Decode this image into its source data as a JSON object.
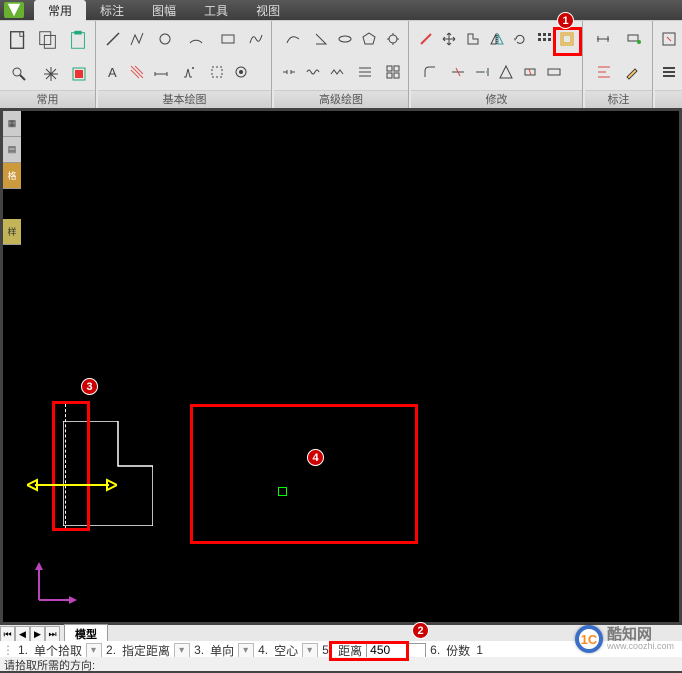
{
  "tabs": {
    "t0": "常用",
    "t1": "标注",
    "t2": "图幅",
    "t3": "工具",
    "t4": "视图"
  },
  "panels": {
    "p0": "常用",
    "p1": "基本绘图",
    "p2": "高级绘图",
    "p3": "修改",
    "p4": "标注"
  },
  "callouts": {
    "c1": "1",
    "c2": "2",
    "c3": "3",
    "c4": "4"
  },
  "model_tab": "模型",
  "options": {
    "o1_num": "1.",
    "o1": "单个拾取",
    "o2_num": "2.",
    "o2": "指定距离",
    "o3_num": "3.",
    "o3": "单向",
    "o4_num": "4.",
    "o4": "空心",
    "o5_num": "5.",
    "o5": "距离",
    "o5_val": "450",
    "o6_num": "6.",
    "o6": "份数",
    "o6_val": "1"
  },
  "status": "请拾取所需的方向:",
  "watermark": {
    "logo": "1C",
    "name": "酷知网",
    "url": "www.coozhi.com"
  }
}
